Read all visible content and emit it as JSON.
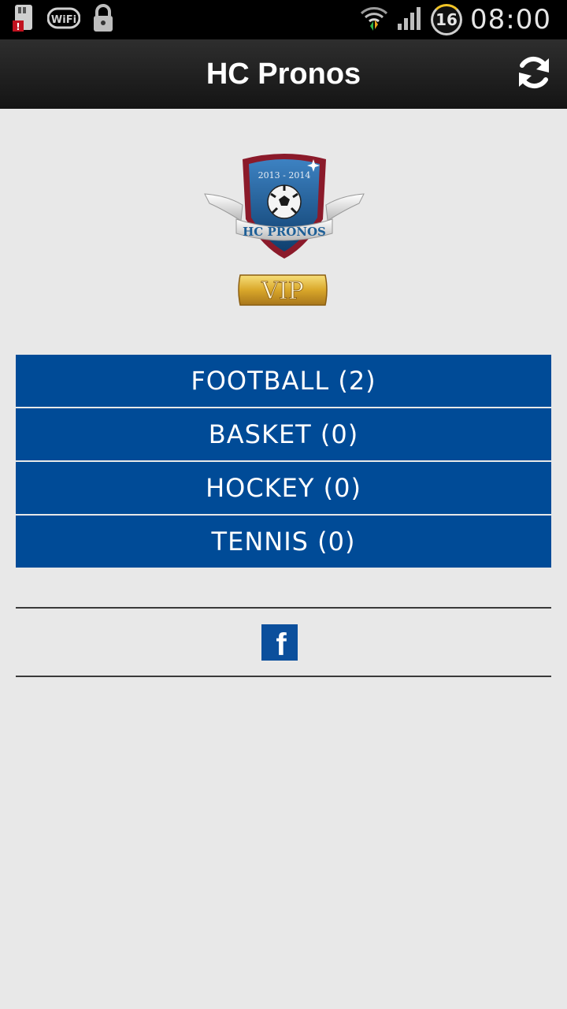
{
  "status_bar": {
    "time": "08:00",
    "notification_count": "16",
    "icons": [
      "sd-card-alert-icon",
      "wifi-status-icon",
      "lock-icon",
      "wifi-signal-icon",
      "cell-signal-icon"
    ]
  },
  "action_bar": {
    "title": "HC Pronos",
    "refresh_icon": "refresh-icon"
  },
  "logo": {
    "season": "2013 - 2014",
    "brand": "HC PRONOS",
    "badge": "VIP"
  },
  "menu": {
    "items": [
      {
        "label": "FOOTBALL (2)"
      },
      {
        "label": "BASKET (0)"
      },
      {
        "label": "HOCKEY (0)"
      },
      {
        "label": "TENNIS (0)"
      }
    ]
  },
  "footer": {
    "facebook_letter": "f",
    "facebook_color": "#0b4f9c"
  },
  "colors": {
    "menu_bg": "#004b97",
    "page_bg": "#e8e8e8",
    "shield_red": "#8b1a2a",
    "shield_blue": "#1d5f97",
    "gold": "#d9a72a"
  }
}
